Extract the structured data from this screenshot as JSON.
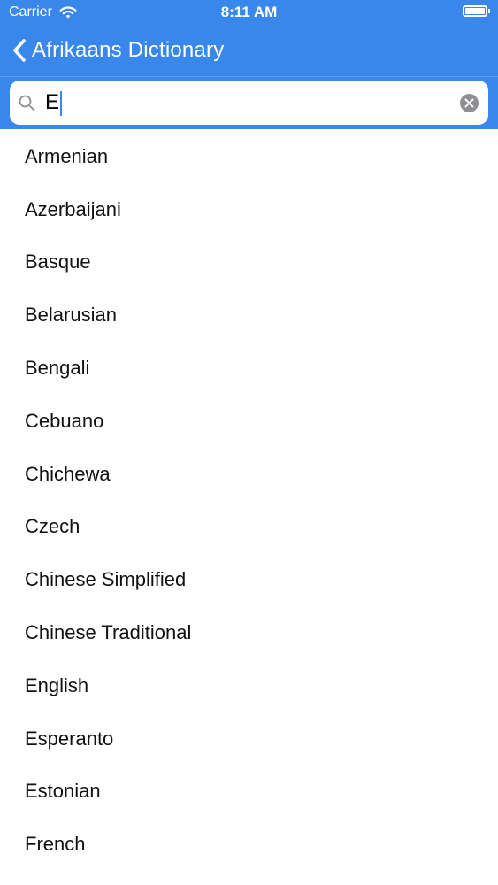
{
  "status_bar": {
    "carrier": "Carrier",
    "time": "8:11 AM",
    "battery_level": 1.0
  },
  "nav": {
    "back_title": "Afrikaans Dictionary"
  },
  "search": {
    "value": "E",
    "placeholder": ""
  },
  "colors": {
    "accent": "#3a87ec",
    "text": "#111111",
    "clear_button": "#8e8e93"
  },
  "icons": {
    "back": "chevron-left-icon",
    "search": "magnifier-icon",
    "clear": "x-circle-icon",
    "wifi": "wifi-icon",
    "battery": "battery-icon"
  },
  "languages": [
    "Armenian",
    "Azerbaijani",
    "Basque",
    "Belarusian",
    "Bengali",
    "Cebuano",
    "Chichewa",
    "Czech",
    "Chinese Simplified",
    "Chinese Traditional",
    "English",
    "Esperanto",
    "Estonian",
    "French"
  ]
}
